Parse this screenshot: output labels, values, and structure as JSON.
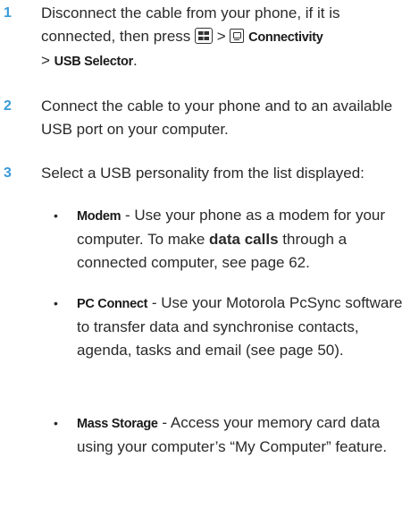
{
  "steps": [
    {
      "number": "1",
      "text_a": "Disconnect the cable from your phone, if it is connected, then press",
      "sep1": ">",
      "menu1": "Connectivity",
      "sep2": ">",
      "menu2": "USB Selector",
      "end": "."
    },
    {
      "number": "2",
      "text": "Connect the cable to your phone and to an available USB port on your computer."
    },
    {
      "number": "3",
      "text": "Select a USB personality from the list displayed:"
    }
  ],
  "options": [
    {
      "term": "Modem",
      "text_a": " - Use your phone as a modem for your computer. To make ",
      "bold": "data calls",
      "text_b": " through a connected computer, see page 62."
    },
    {
      "term": "PC Connect",
      "text_a": " - Use your Motorola PcSync software to transfer data and synchronise contacts, agenda, tasks and email (see page 50)."
    },
    {
      "term": "Mass Storage",
      "text_a": " - Access your memory card data using your computer’s “My Computer” feature."
    }
  ],
  "bullet_glyph": "•",
  "icons": {
    "menu_key": "menu-key-icon",
    "connectivity": "connectivity-icon"
  },
  "colors": {
    "step_number": "#3a9bd9",
    "text": "#2a2a2a"
  }
}
